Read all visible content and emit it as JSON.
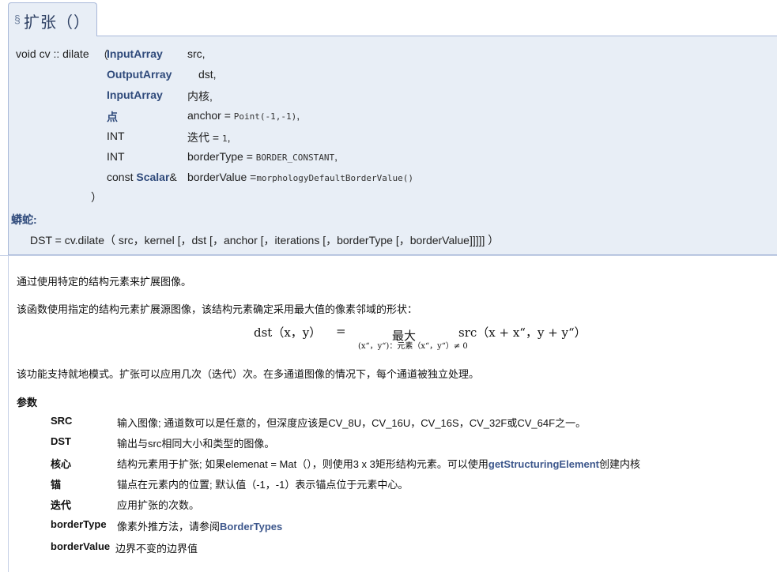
{
  "header": {
    "section_symbol": "§",
    "title": "扩张（）"
  },
  "prototype": {
    "return_type": "void",
    "namespace": "cv",
    "sep": "::",
    "func_name": "dilate",
    "open_paren": "（",
    "close_paren": "）",
    "params": [
      {
        "type": "InputArray",
        "type_is_link": true,
        "name": "src,",
        "default": ""
      },
      {
        "type": "OutputArray",
        "type_is_link": true,
        "name": "dst,",
        "default": ""
      },
      {
        "type": "InputArray",
        "type_is_link": true,
        "name": "内核,",
        "default": ""
      },
      {
        "type": "点",
        "type_is_link": true,
        "name": "anchor =",
        "default": "Point(-1,-1)",
        "tail": ","
      },
      {
        "type": "INT",
        "type_is_link": false,
        "name": "迭代 =",
        "default": "1",
        "tail": ","
      },
      {
        "type": "INT",
        "type_is_link": false,
        "name": "borderType =",
        "default": "BORDER_CONSTANT",
        "tail": ","
      },
      {
        "type_prefix": "const ",
        "type": "Scalar",
        "type_suffix": "&",
        "type_is_link": true,
        "name": "borderValue =",
        "default": "morphologyDefaultBorderValue()",
        "tail": ""
      }
    ]
  },
  "python": {
    "label": "蟒蛇:",
    "signature": "DST = cv.dilate（ src，kernel [，dst [，anchor [，iterations [，borderType [，borderValue]]]]] ）"
  },
  "description": {
    "p1": "通过使用特定的结构元素来扩展图像。",
    "p2": "该函数使用指定的结构元素扩展源图像，该结构元素确定采用最大值的像素邻域的形状：",
    "p3": "该功能支持就地模式。扩张可以应用几次（迭代）次。在多通道图像的情况下，每个通道被独立处理。"
  },
  "formula": {
    "lhs": "dst（x，y）",
    "eq": "=",
    "op": "最大",
    "sub": "(x“，y“)：元素（x“，y“）≠ 0",
    "rhs": "src（x + x“，y + y“）"
  },
  "params_section": {
    "title": "参数",
    "items": [
      {
        "name": "SRC",
        "desc": "输入图像; 通道数可以是任意的，但深度应该是CV_8U，CV_16U，CV_16S，CV_32F或CV_64F之一。"
      },
      {
        "name": "DST",
        "desc": "输出与src相同大小和类型的图像。"
      },
      {
        "name": "核心",
        "desc": "结构元素用于扩张; 如果elemenat = Mat（），则使用3 x 3矩形结构元素。可以使用",
        "link": "getStructuringElement",
        "desc_after": "创建内核"
      },
      {
        "name": "锚",
        "desc": "锚点在元素内的位置; 默认值（-1，-1）表示锚点位于元素中心。"
      },
      {
        "name": "迭代",
        "desc": "应用扩张的次数。"
      },
      {
        "name": "borderType",
        "desc": "像素外推方法，请参阅",
        "link": "BorderTypes"
      },
      {
        "name": "borderValue",
        "desc": "边界不变的边界值"
      }
    ]
  }
}
